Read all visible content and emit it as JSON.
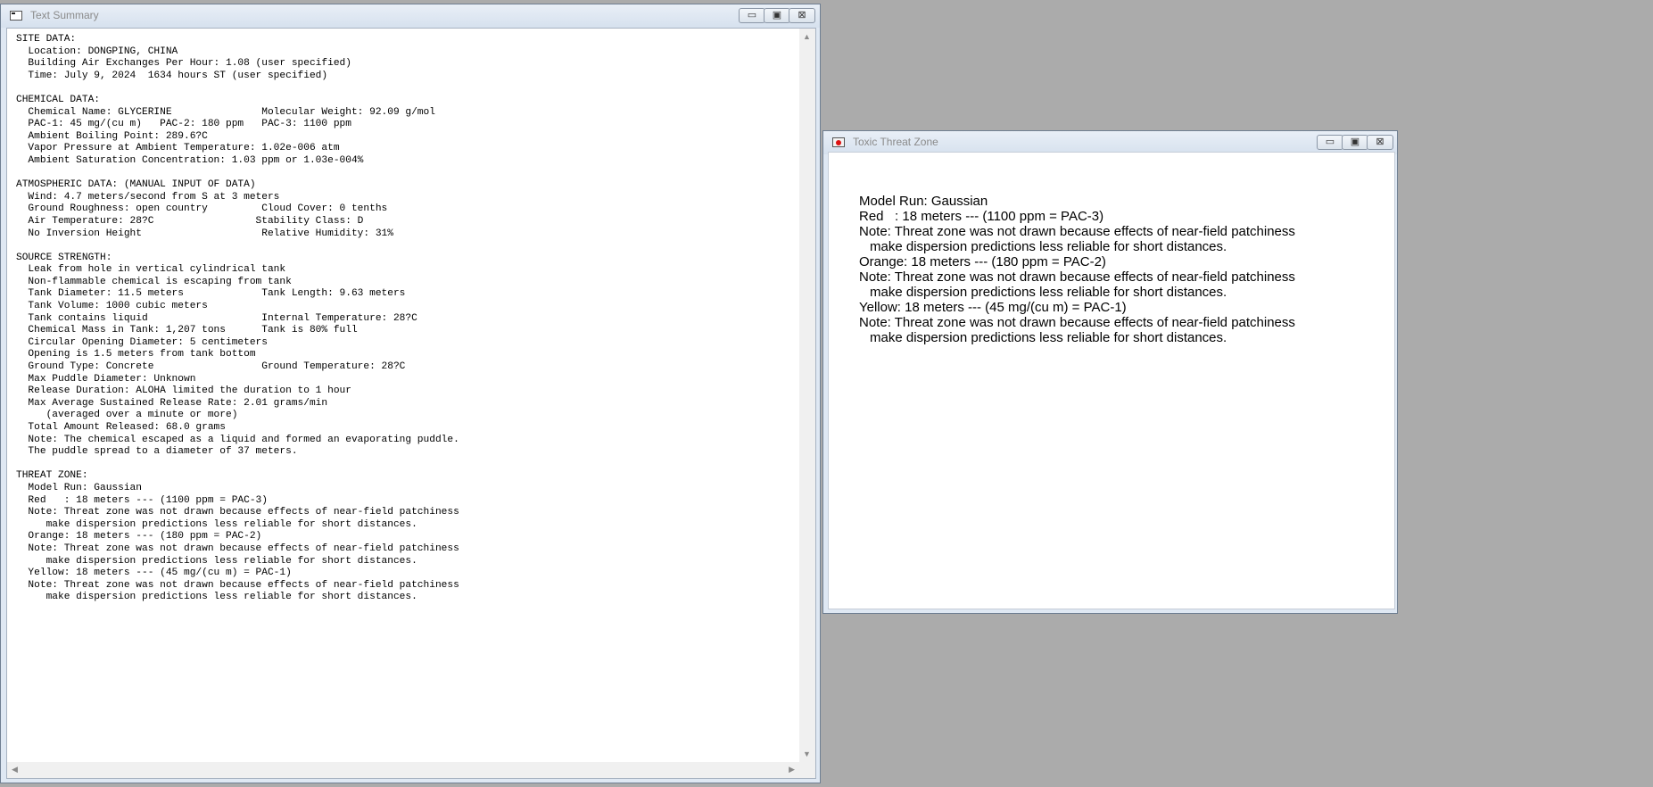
{
  "summary_window": {
    "title": "Text Summary",
    "controls": {
      "minimize": "▭",
      "maximize": "▣",
      "close": "⊠"
    },
    "report_lines": [
      "SITE DATA:",
      "  Location: DONGPING, CHINA",
      "  Building Air Exchanges Per Hour: 1.08 (user specified)",
      "  Time: July 9, 2024  1634 hours ST (user specified)",
      "",
      "CHEMICAL DATA:",
      "  Chemical Name: GLYCERINE               Molecular Weight: 92.09 g/mol",
      "  PAC-1: 45 mg/(cu m)   PAC-2: 180 ppm   PAC-3: 1100 ppm",
      "  Ambient Boiling Point: 289.6?C",
      "  Vapor Pressure at Ambient Temperature: 1.02e-006 atm",
      "  Ambient Saturation Concentration: 1.03 ppm or 1.03e-004%",
      "",
      "ATMOSPHERIC DATA: (MANUAL INPUT OF DATA)",
      "  Wind: 4.7 meters/second from S at 3 meters",
      "  Ground Roughness: open country         Cloud Cover: 0 tenths",
      "  Air Temperature: 28?C                 Stability Class: D",
      "  No Inversion Height                    Relative Humidity: 31%",
      "",
      "SOURCE STRENGTH:",
      "  Leak from hole in vertical cylindrical tank",
      "  Non-flammable chemical is escaping from tank",
      "  Tank Diameter: 11.5 meters             Tank Length: 9.63 meters",
      "  Tank Volume: 1000 cubic meters",
      "  Tank contains liquid                   Internal Temperature: 28?C",
      "  Chemical Mass in Tank: 1,207 tons      Tank is 80% full",
      "  Circular Opening Diameter: 5 centimeters",
      "  Opening is 1.5 meters from tank bottom",
      "  Ground Type: Concrete                  Ground Temperature: 28?C",
      "  Max Puddle Diameter: Unknown",
      "  Release Duration: ALOHA limited the duration to 1 hour",
      "  Max Average Sustained Release Rate: 2.01 grams/min",
      "     (averaged over a minute or more)",
      "  Total Amount Released: 68.0 grams",
      "  Note: The chemical escaped as a liquid and formed an evaporating puddle.",
      "  The puddle spread to a diameter of 37 meters.",
      "",
      "THREAT ZONE:",
      "  Model Run: Gaussian",
      "  Red   : 18 meters --- (1100 ppm = PAC-3)",
      "  Note: Threat zone was not drawn because effects of near-field patchiness",
      "     make dispersion predictions less reliable for short distances.",
      "  Orange: 18 meters --- (180 ppm = PAC-2)",
      "  Note: Threat zone was not drawn because effects of near-field patchiness",
      "     make dispersion predictions less reliable for short distances.",
      "  Yellow: 18 meters --- (45 mg/(cu m) = PAC-1)",
      "  Note: Threat zone was not drawn because effects of near-field patchiness",
      "     make dispersion predictions less reliable for short distances."
    ]
  },
  "threat_window": {
    "title": "Toxic Threat Zone",
    "controls": {
      "minimize": "▭",
      "maximize": "▣",
      "close": "⊠"
    },
    "model_run": "Model Run: Gaussian",
    "red": "Red   : 18 meters --- (1100 ppm = PAC-3)",
    "note1a": "Note: Threat zone was not drawn because effects of near-field patchiness",
    "note1b": "make dispersion predictions less reliable for short distances.",
    "orange": "Orange: 18 meters --- (180 ppm = PAC-2)",
    "note2a": "Note: Threat zone was not drawn because effects of near-field patchiness",
    "note2b": "make dispersion predictions less reliable for short distances.",
    "yellow": "Yellow: 18 meters --- (45 mg/(cu m) = PAC-1)",
    "note3a": "Note: Threat zone was not drawn because effects of near-field patchiness",
    "note3b": "make dispersion predictions less reliable for short distances."
  },
  "scroll_arrows": {
    "up": "▲",
    "down": "▼",
    "left": "◀",
    "right": "▶"
  },
  "colors": {
    "desktop": "#ababab",
    "window_frame": "#dfe8f3",
    "title_text": "#8a8a8a"
  }
}
